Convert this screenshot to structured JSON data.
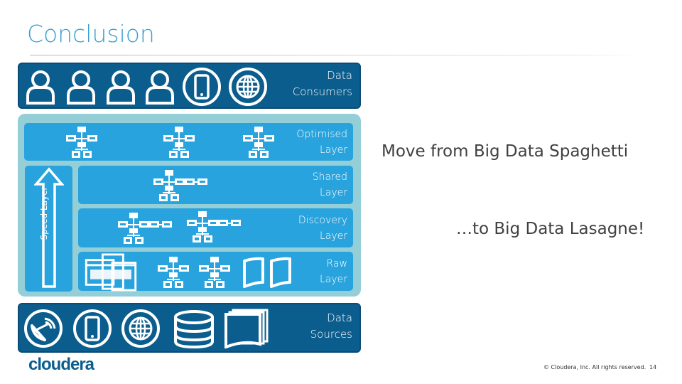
{
  "slide": {
    "title": "Conclusion",
    "headline": "Move from Big Data Spaghetti",
    "subline": "…to Big Data Lasagne!",
    "logo": "cloudera",
    "copyright": "© Cloudera, Inc. All rights reserved.",
    "page_number": "14"
  },
  "diagram": {
    "consumers": {
      "label_line1": "Data",
      "label_line2": "Consumers",
      "icons": [
        "user-icon",
        "user-icon",
        "user-icon",
        "user-icon",
        "mobile-icon",
        "globe-icon"
      ]
    },
    "layers": [
      {
        "line1": "Optimised",
        "line2": "Layer"
      },
      {
        "line1": "Shared",
        "line2": "Layer"
      },
      {
        "line1": "Discovery",
        "line2": "Layer"
      },
      {
        "line1": "Raw",
        "line2": "Layer"
      }
    ],
    "speed_layer": {
      "label": "Speed Layer"
    },
    "sources": {
      "label_line1": "Data",
      "label_line2": "Sources",
      "icons": [
        "satellite-icon",
        "mobile-icon",
        "globe-icon",
        "database-icon",
        "documents-icon"
      ]
    }
  },
  "colors": {
    "title": "#3a9fcf",
    "dark_band": "#0b5d8d",
    "layer": "#29a3dd",
    "container": "#94ced7"
  }
}
